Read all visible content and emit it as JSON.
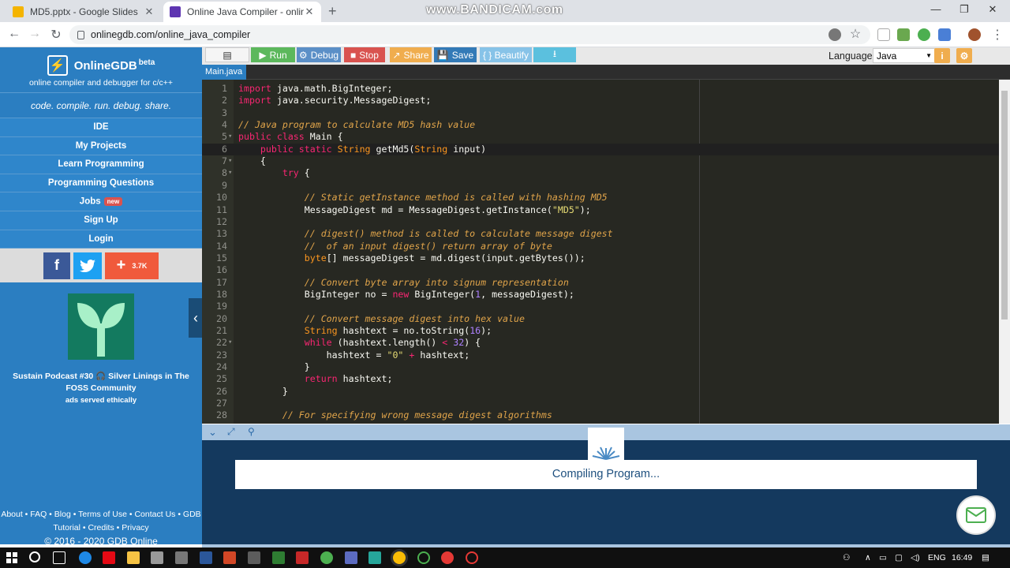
{
  "browser": {
    "tabs": [
      {
        "title": "MD5.pptx - Google Slides",
        "active": false,
        "color": "#f4b400"
      },
      {
        "title": "Online Java Compiler - online ed",
        "active": true,
        "color": "#5e35b1"
      }
    ],
    "watermark": "www.BANDICAM.com",
    "url": "onlinegdb.com/online_java_compiler"
  },
  "sidebar": {
    "brand": "OnlineGDB",
    "beta": "beta",
    "subtitle": "online compiler and debugger for c/c++",
    "tagline": "code. compile. run. debug. share.",
    "menu": [
      "IDE",
      "My Projects",
      "Learn Programming",
      "Programming Questions",
      "Jobs",
      "Sign Up",
      "Login"
    ],
    "jobs_badge": "new",
    "share_count": "3.7K",
    "podcast_title": "Sustain Podcast #30 🎧 Silver Linings in The FOSS Community",
    "ads_text": "ads served ethically",
    "footer_line1": "About • FAQ • Blog • Terms of Use • Contact Us • GDB",
    "footer_line2": "Tutorial • Credits • Privacy",
    "copyright": "© 2016 - 2020 GDB Online"
  },
  "toolbar": {
    "run": "Run",
    "debug": "Debug",
    "stop": "Stop",
    "share": "Share",
    "save": "Save",
    "beautify": "{ } Beautify",
    "language_label": "Language",
    "language": "Java",
    "colors": {
      "run": "#5cb85c",
      "debug": "#5b8fc7",
      "stop": "#d9534f",
      "share": "#f0ad4e",
      "save": "#337ab7",
      "beautify": "#87c3e8",
      "download": "#5bc0de"
    }
  },
  "file_tab": "Main.java",
  "code_lines": [
    {
      "n": "1",
      "tokens": [
        [
          "k",
          "import"
        ],
        [
          "t",
          " java.math.BigInteger;"
        ]
      ]
    },
    {
      "n": "2",
      "tokens": [
        [
          "k",
          "import"
        ],
        [
          "t",
          " java.security.MessageDigest;"
        ]
      ]
    },
    {
      "n": "3",
      "tokens": []
    },
    {
      "n": "4",
      "tokens": [
        [
          "c",
          "// Java program to calculate MD5 hash value"
        ]
      ]
    },
    {
      "n": "5",
      "fold": true,
      "tokens": [
        [
          "k",
          "public class"
        ],
        [
          "t",
          " Main {"
        ]
      ]
    },
    {
      "n": "6",
      "tokens": [
        [
          "t",
          "    "
        ],
        [
          "k",
          "public static"
        ],
        [
          "t",
          " "
        ],
        [
          "y",
          "String"
        ],
        [
          "t",
          " getMd5("
        ],
        [
          "y",
          "String"
        ],
        [
          "t",
          " input)"
        ]
      ]
    },
    {
      "n": "7",
      "fold": true,
      "tokens": [
        [
          "t",
          "    {"
        ]
      ]
    },
    {
      "n": "8",
      "fold": true,
      "tokens": [
        [
          "t",
          "        "
        ],
        [
          "k",
          "try"
        ],
        [
          "t",
          " {"
        ]
      ]
    },
    {
      "n": "9",
      "tokens": []
    },
    {
      "n": "10",
      "tokens": [
        [
          "t",
          "            "
        ],
        [
          "c",
          "// Static getInstance method is called with hashing MD5"
        ]
      ]
    },
    {
      "n": "11",
      "tokens": [
        [
          "t",
          "            MessageDigest md = MessageDigest.getInstance("
        ],
        [
          "s",
          "\"MD5\""
        ],
        [
          "t",
          ");"
        ]
      ]
    },
    {
      "n": "12",
      "tokens": []
    },
    {
      "n": "13",
      "tokens": [
        [
          "t",
          "            "
        ],
        [
          "c",
          "// digest() method is called to calculate message digest"
        ]
      ]
    },
    {
      "n": "14",
      "tokens": [
        [
          "t",
          "            "
        ],
        [
          "c",
          "//  of an input digest() return array of byte"
        ]
      ]
    },
    {
      "n": "15",
      "tokens": [
        [
          "t",
          "            "
        ],
        [
          "y",
          "byte"
        ],
        [
          "t",
          "[] messageDigest = md.digest(input.getBytes());"
        ]
      ]
    },
    {
      "n": "16",
      "tokens": []
    },
    {
      "n": "17",
      "tokens": [
        [
          "t",
          "            "
        ],
        [
          "c",
          "// Convert byte array into signum representation"
        ]
      ]
    },
    {
      "n": "18",
      "tokens": [
        [
          "t",
          "            BigInteger no = "
        ],
        [
          "k",
          "new"
        ],
        [
          "t",
          " BigInteger("
        ],
        [
          "n",
          "1"
        ],
        [
          "t",
          ", messageDigest);"
        ]
      ]
    },
    {
      "n": "19",
      "tokens": []
    },
    {
      "n": "20",
      "tokens": [
        [
          "t",
          "            "
        ],
        [
          "c",
          "// Convert message digest into hex value"
        ]
      ]
    },
    {
      "n": "21",
      "tokens": [
        [
          "t",
          "            "
        ],
        [
          "y",
          "String"
        ],
        [
          "t",
          " hashtext = no.toString("
        ],
        [
          "n",
          "16"
        ],
        [
          "t",
          ");"
        ]
      ]
    },
    {
      "n": "22",
      "fold": true,
      "tokens": [
        [
          "t",
          "            "
        ],
        [
          "k",
          "while"
        ],
        [
          "t",
          " (hashtext.length() "
        ],
        [
          "k",
          "<"
        ],
        [
          "t",
          " "
        ],
        [
          "n",
          "32"
        ],
        [
          "t",
          ") {"
        ]
      ]
    },
    {
      "n": "23",
      "tokens": [
        [
          "t",
          "                hashtext = "
        ],
        [
          "s",
          "\"0\""
        ],
        [
          "t",
          " "
        ],
        [
          "k",
          "+"
        ],
        [
          "t",
          " hashtext;"
        ]
      ]
    },
    {
      "n": "24",
      "tokens": [
        [
          "t",
          "            }"
        ]
      ]
    },
    {
      "n": "25",
      "tokens": [
        [
          "t",
          "            "
        ],
        [
          "k",
          "return"
        ],
        [
          "t",
          " hashtext;"
        ]
      ]
    },
    {
      "n": "26",
      "tokens": [
        [
          "t",
          "        }"
        ]
      ]
    },
    {
      "n": "27",
      "tokens": []
    },
    {
      "n": "28",
      "tokens": [
        [
          "t",
          "        "
        ],
        [
          "c",
          "// For specifying wrong message digest algorithms"
        ]
      ]
    }
  ],
  "output": {
    "status": "Compiling Program..."
  },
  "taskbar": {
    "lang": "ENG",
    "time": "16:49"
  }
}
